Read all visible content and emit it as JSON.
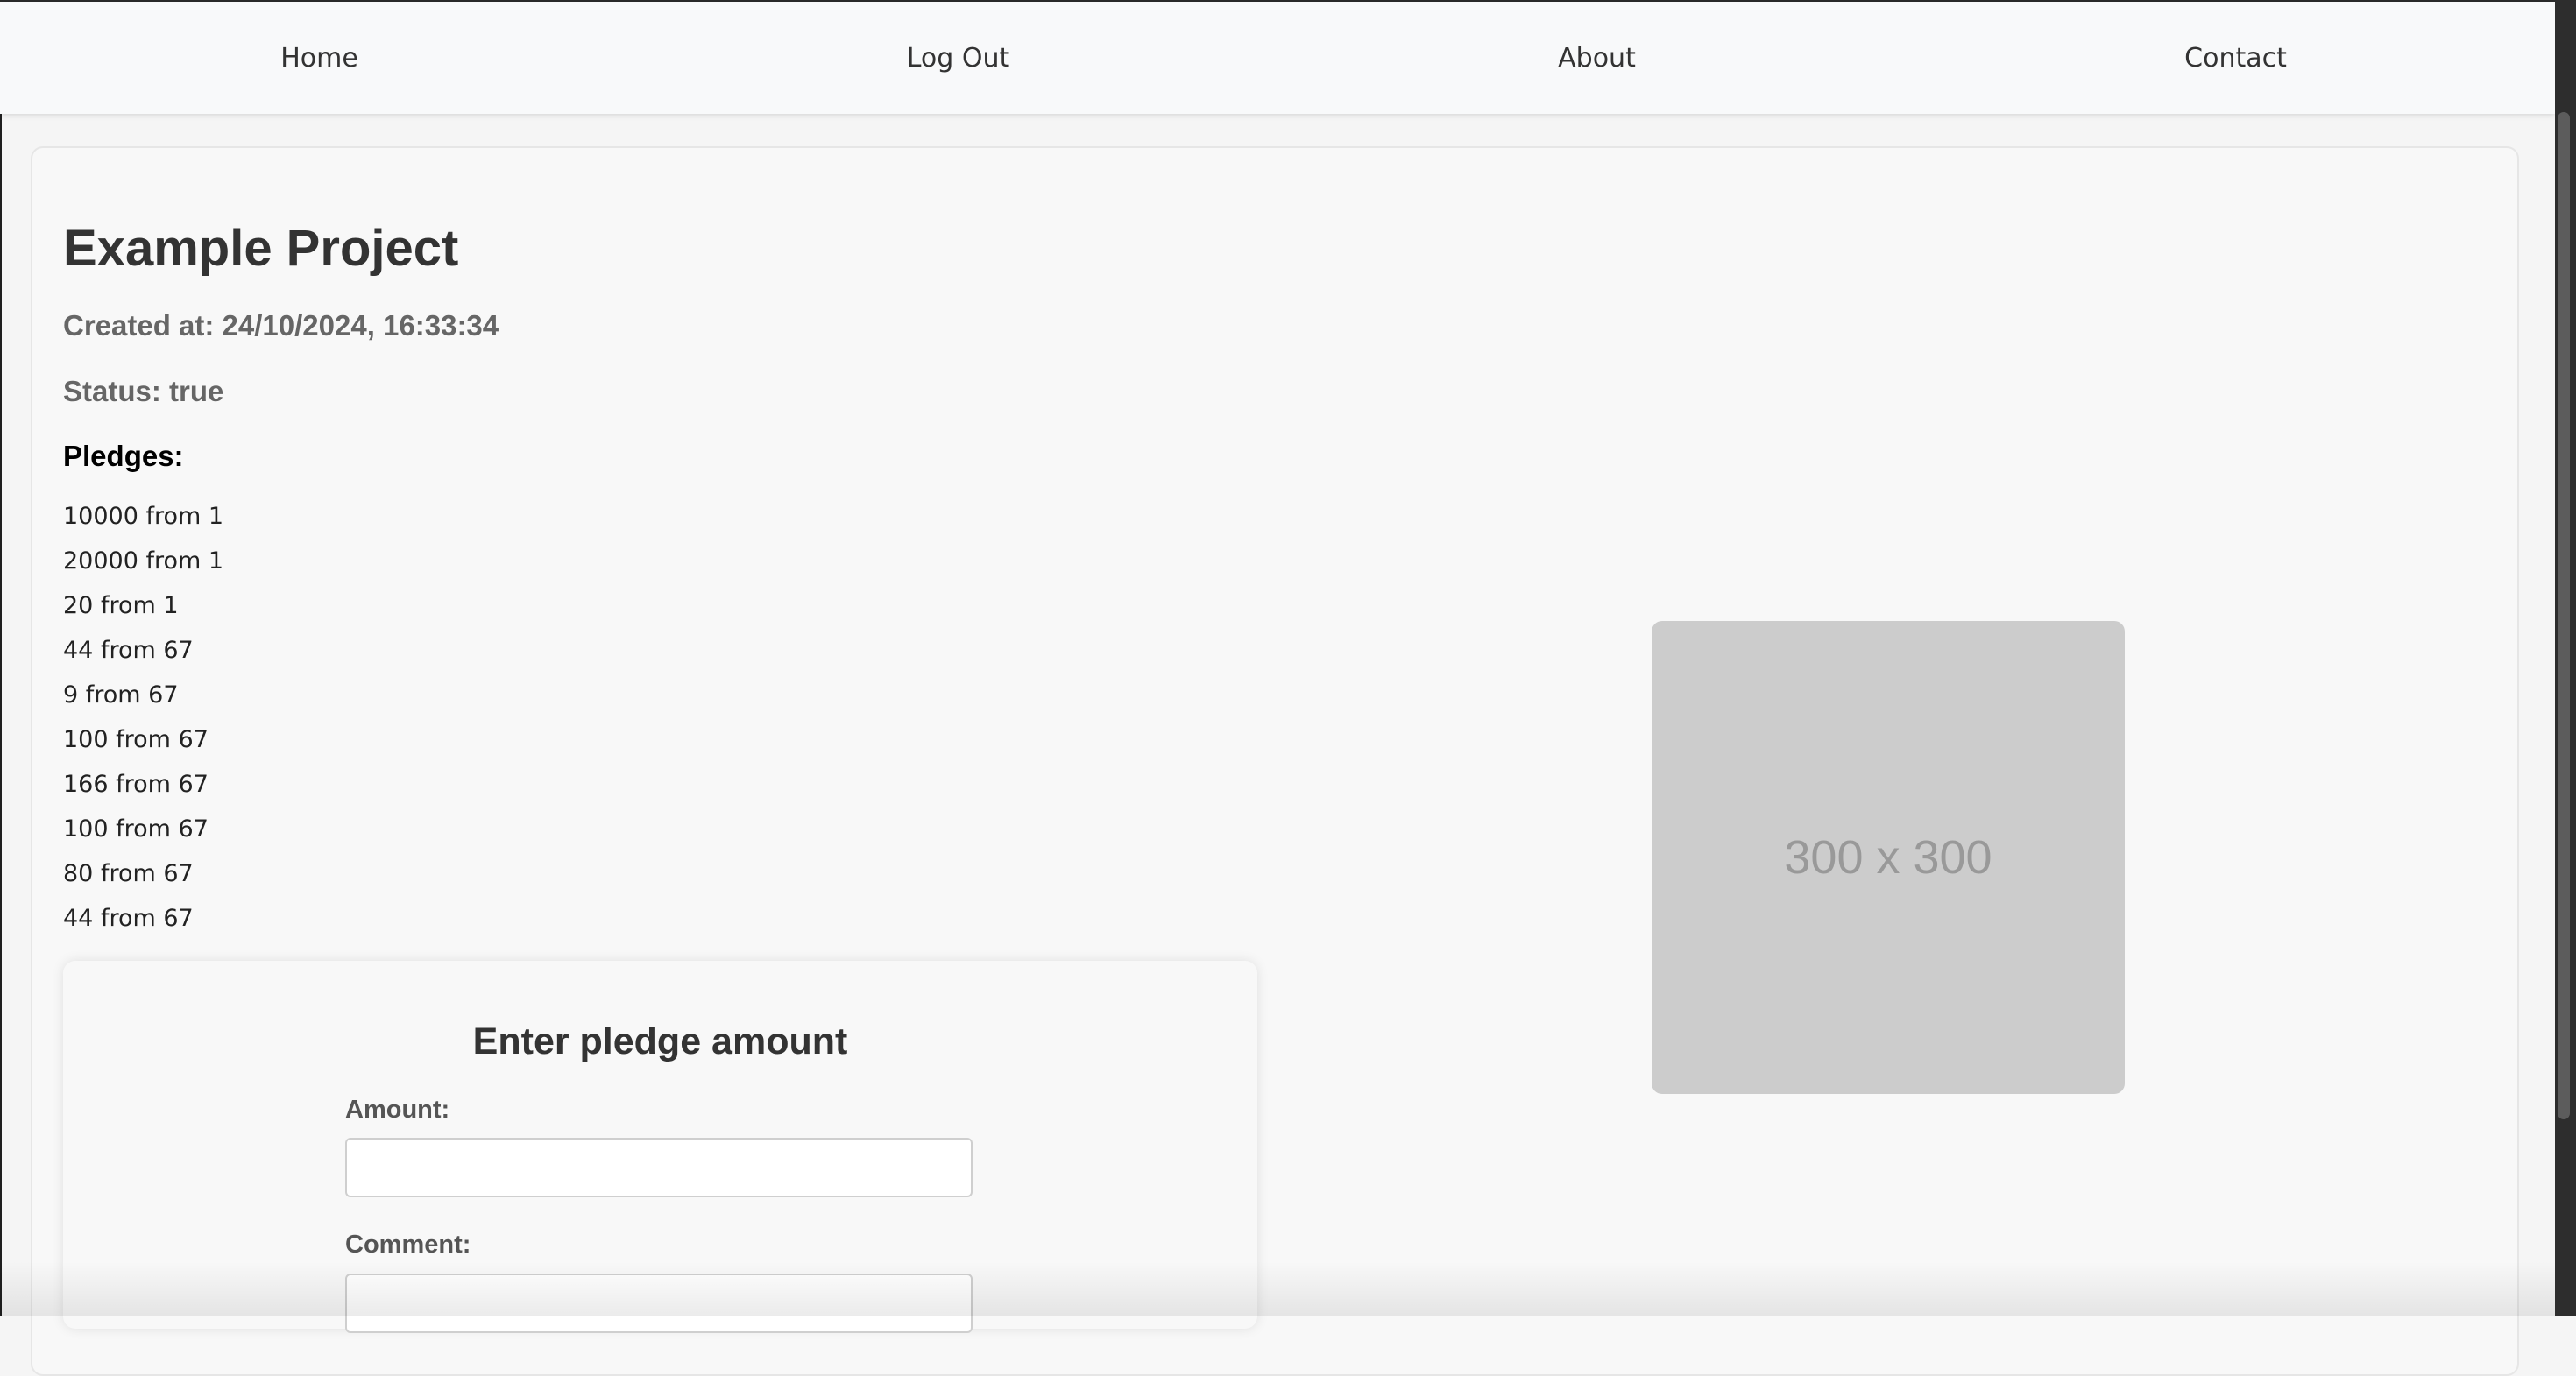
{
  "nav": {
    "items": [
      {
        "label": "Home"
      },
      {
        "label": "Log Out"
      },
      {
        "label": "About"
      },
      {
        "label": "Contact"
      }
    ]
  },
  "project": {
    "title": "Example Project",
    "created": "Created at: 24/10/2024, 16:33:34",
    "status": "Status: true",
    "pledges_heading": "Pledges:",
    "pledges": [
      "10000 from 1",
      "20000 from 1",
      "20 from 1",
      "44 from 67",
      "9 from 67",
      "100 from 67",
      "166 from 67",
      "100 from 67",
      "80 from 67",
      "44 from 67"
    ]
  },
  "form": {
    "title": "Enter pledge amount",
    "amount_label": "Amount:",
    "amount_value": "",
    "comment_label": "Comment:",
    "comment_value": ""
  },
  "image": {
    "placeholder_text": "300 x 300"
  }
}
